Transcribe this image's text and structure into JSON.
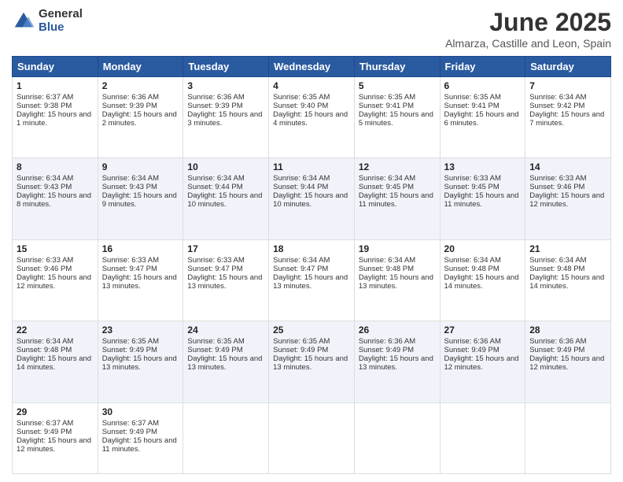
{
  "logo": {
    "general": "General",
    "blue": "Blue"
  },
  "header": {
    "month": "June 2025",
    "location": "Almarza, Castille and Leon, Spain"
  },
  "weekdays": [
    "Sunday",
    "Monday",
    "Tuesday",
    "Wednesday",
    "Thursday",
    "Friday",
    "Saturday"
  ],
  "weeks": [
    [
      {
        "day": 1,
        "sunrise": "6:37 AM",
        "sunset": "9:38 PM",
        "daylight": "15 hours and 1 minute."
      },
      {
        "day": 2,
        "sunrise": "6:36 AM",
        "sunset": "9:39 PM",
        "daylight": "15 hours and 2 minutes."
      },
      {
        "day": 3,
        "sunrise": "6:36 AM",
        "sunset": "9:39 PM",
        "daylight": "15 hours and 3 minutes."
      },
      {
        "day": 4,
        "sunrise": "6:35 AM",
        "sunset": "9:40 PM",
        "daylight": "15 hours and 4 minutes."
      },
      {
        "day": 5,
        "sunrise": "6:35 AM",
        "sunset": "9:41 PM",
        "daylight": "15 hours and 5 minutes."
      },
      {
        "day": 6,
        "sunrise": "6:35 AM",
        "sunset": "9:41 PM",
        "daylight": "15 hours and 6 minutes."
      },
      {
        "day": 7,
        "sunrise": "6:34 AM",
        "sunset": "9:42 PM",
        "daylight": "15 hours and 7 minutes."
      }
    ],
    [
      {
        "day": 8,
        "sunrise": "6:34 AM",
        "sunset": "9:43 PM",
        "daylight": "15 hours and 8 minutes."
      },
      {
        "day": 9,
        "sunrise": "6:34 AM",
        "sunset": "9:43 PM",
        "daylight": "15 hours and 9 minutes."
      },
      {
        "day": 10,
        "sunrise": "6:34 AM",
        "sunset": "9:44 PM",
        "daylight": "15 hours and 10 minutes."
      },
      {
        "day": 11,
        "sunrise": "6:34 AM",
        "sunset": "9:44 PM",
        "daylight": "15 hours and 10 minutes."
      },
      {
        "day": 12,
        "sunrise": "6:34 AM",
        "sunset": "9:45 PM",
        "daylight": "15 hours and 11 minutes."
      },
      {
        "day": 13,
        "sunrise": "6:33 AM",
        "sunset": "9:45 PM",
        "daylight": "15 hours and 11 minutes."
      },
      {
        "day": 14,
        "sunrise": "6:33 AM",
        "sunset": "9:46 PM",
        "daylight": "15 hours and 12 minutes."
      }
    ],
    [
      {
        "day": 15,
        "sunrise": "6:33 AM",
        "sunset": "9:46 PM",
        "daylight": "15 hours and 12 minutes."
      },
      {
        "day": 16,
        "sunrise": "6:33 AM",
        "sunset": "9:47 PM",
        "daylight": "15 hours and 13 minutes."
      },
      {
        "day": 17,
        "sunrise": "6:33 AM",
        "sunset": "9:47 PM",
        "daylight": "15 hours and 13 minutes."
      },
      {
        "day": 18,
        "sunrise": "6:34 AM",
        "sunset": "9:47 PM",
        "daylight": "15 hours and 13 minutes."
      },
      {
        "day": 19,
        "sunrise": "6:34 AM",
        "sunset": "9:48 PM",
        "daylight": "15 hours and 13 minutes."
      },
      {
        "day": 20,
        "sunrise": "6:34 AM",
        "sunset": "9:48 PM",
        "daylight": "15 hours and 14 minutes."
      },
      {
        "day": 21,
        "sunrise": "6:34 AM",
        "sunset": "9:48 PM",
        "daylight": "15 hours and 14 minutes."
      }
    ],
    [
      {
        "day": 22,
        "sunrise": "6:34 AM",
        "sunset": "9:48 PM",
        "daylight": "15 hours and 14 minutes."
      },
      {
        "day": 23,
        "sunrise": "6:35 AM",
        "sunset": "9:49 PM",
        "daylight": "15 hours and 13 minutes."
      },
      {
        "day": 24,
        "sunrise": "6:35 AM",
        "sunset": "9:49 PM",
        "daylight": "15 hours and 13 minutes."
      },
      {
        "day": 25,
        "sunrise": "6:35 AM",
        "sunset": "9:49 PM",
        "daylight": "15 hours and 13 minutes."
      },
      {
        "day": 26,
        "sunrise": "6:36 AM",
        "sunset": "9:49 PM",
        "daylight": "15 hours and 13 minutes."
      },
      {
        "day": 27,
        "sunrise": "6:36 AM",
        "sunset": "9:49 PM",
        "daylight": "15 hours and 12 minutes."
      },
      {
        "day": 28,
        "sunrise": "6:36 AM",
        "sunset": "9:49 PM",
        "daylight": "15 hours and 12 minutes."
      }
    ],
    [
      {
        "day": 29,
        "sunrise": "6:37 AM",
        "sunset": "9:49 PM",
        "daylight": "15 hours and 12 minutes."
      },
      {
        "day": 30,
        "sunrise": "6:37 AM",
        "sunset": "9:49 PM",
        "daylight": "15 hours and 11 minutes."
      },
      null,
      null,
      null,
      null,
      null
    ]
  ]
}
